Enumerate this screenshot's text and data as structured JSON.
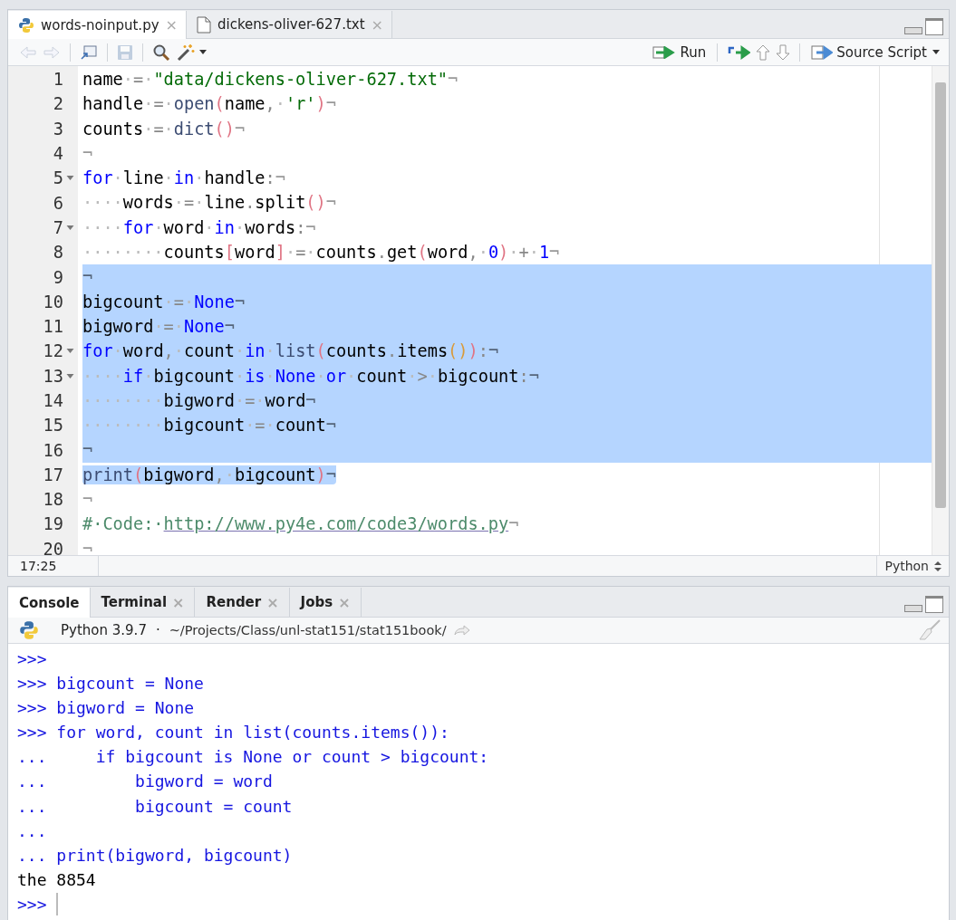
{
  "source_tabs": [
    {
      "label": "words-noinput.py",
      "kind": "python",
      "selected": true,
      "close_icon": "×"
    },
    {
      "label": "dickens-oliver-627.txt",
      "kind": "text",
      "selected": false,
      "close_icon": "×"
    }
  ],
  "toolbar": {
    "run_label": "Run",
    "source_label": "Source Script",
    "back_disabled": true,
    "forward_disabled": true,
    "save_disabled": true
  },
  "editor": {
    "lines": [
      {
        "number": "1",
        "foldable": false,
        "selected": false,
        "tokens": [
          {
            "kind": "id",
            "text": "name"
          },
          {
            "kind": "ws",
            "text": "·"
          },
          {
            "kind": "op",
            "text": "="
          },
          {
            "kind": "ws",
            "text": "·"
          },
          {
            "kind": "str",
            "text": "\"data/dickens-oliver-627.txt\""
          },
          {
            "kind": "eol",
            "text": "¬"
          }
        ]
      },
      {
        "number": "2",
        "foldable": false,
        "selected": false,
        "tokens": [
          {
            "kind": "id",
            "text": "handle"
          },
          {
            "kind": "ws",
            "text": "·"
          },
          {
            "kind": "op",
            "text": "="
          },
          {
            "kind": "ws",
            "text": "·"
          },
          {
            "kind": "builtin",
            "text": "open"
          },
          {
            "kind": "paren",
            "text": "("
          },
          {
            "kind": "id",
            "text": "name"
          },
          {
            "kind": "op",
            "text": ","
          },
          {
            "kind": "ws",
            "text": "·"
          },
          {
            "kind": "str",
            "text": "'r'"
          },
          {
            "kind": "paren",
            "text": ")"
          },
          {
            "kind": "eol",
            "text": "¬"
          }
        ]
      },
      {
        "number": "3",
        "foldable": false,
        "selected": false,
        "tokens": [
          {
            "kind": "id",
            "text": "counts"
          },
          {
            "kind": "ws",
            "text": "·"
          },
          {
            "kind": "op",
            "text": "="
          },
          {
            "kind": "ws",
            "text": "·"
          },
          {
            "kind": "builtin",
            "text": "dict"
          },
          {
            "kind": "paren",
            "text": "()"
          },
          {
            "kind": "eol",
            "text": "¬"
          }
        ]
      },
      {
        "number": "4",
        "foldable": false,
        "selected": false,
        "tokens": [
          {
            "kind": "eol",
            "text": "¬"
          }
        ]
      },
      {
        "number": "5",
        "foldable": true,
        "selected": false,
        "tokens": [
          {
            "kind": "kw",
            "text": "for"
          },
          {
            "kind": "ws",
            "text": "·"
          },
          {
            "kind": "id",
            "text": "line"
          },
          {
            "kind": "ws",
            "text": "·"
          },
          {
            "kind": "kw",
            "text": "in"
          },
          {
            "kind": "ws",
            "text": "·"
          },
          {
            "kind": "id",
            "text": "handle"
          },
          {
            "kind": "op",
            "text": ":"
          },
          {
            "kind": "eol",
            "text": "¬"
          }
        ]
      },
      {
        "number": "6",
        "foldable": false,
        "selected": false,
        "tokens": [
          {
            "kind": "ws",
            "text": "····"
          },
          {
            "kind": "id",
            "text": "words"
          },
          {
            "kind": "ws",
            "text": "·"
          },
          {
            "kind": "op",
            "text": "="
          },
          {
            "kind": "ws",
            "text": "·"
          },
          {
            "kind": "id",
            "text": "line"
          },
          {
            "kind": "op",
            "text": "."
          },
          {
            "kind": "id",
            "text": "split"
          },
          {
            "kind": "paren",
            "text": "()"
          },
          {
            "kind": "eol",
            "text": "¬"
          }
        ]
      },
      {
        "number": "7",
        "foldable": true,
        "selected": false,
        "tokens": [
          {
            "kind": "ws",
            "text": "····"
          },
          {
            "kind": "kw",
            "text": "for"
          },
          {
            "kind": "ws",
            "text": "·"
          },
          {
            "kind": "id",
            "text": "word"
          },
          {
            "kind": "ws",
            "text": "·"
          },
          {
            "kind": "kw",
            "text": "in"
          },
          {
            "kind": "ws",
            "text": "·"
          },
          {
            "kind": "id",
            "text": "words"
          },
          {
            "kind": "op",
            "text": ":"
          },
          {
            "kind": "eol",
            "text": "¬"
          }
        ]
      },
      {
        "number": "8",
        "foldable": false,
        "selected": false,
        "tokens": [
          {
            "kind": "ws",
            "text": "········"
          },
          {
            "kind": "id",
            "text": "counts"
          },
          {
            "kind": "paren",
            "text": "["
          },
          {
            "kind": "id",
            "text": "word"
          },
          {
            "kind": "paren",
            "text": "]"
          },
          {
            "kind": "ws",
            "text": "·"
          },
          {
            "kind": "op",
            "text": "="
          },
          {
            "kind": "ws",
            "text": "·"
          },
          {
            "kind": "id",
            "text": "counts"
          },
          {
            "kind": "op",
            "text": "."
          },
          {
            "kind": "id",
            "text": "get"
          },
          {
            "kind": "paren",
            "text": "("
          },
          {
            "kind": "id",
            "text": "word"
          },
          {
            "kind": "op",
            "text": ","
          },
          {
            "kind": "ws",
            "text": "·"
          },
          {
            "kind": "num",
            "text": "0"
          },
          {
            "kind": "paren",
            "text": ")"
          },
          {
            "kind": "ws",
            "text": "·"
          },
          {
            "kind": "op",
            "text": "+"
          },
          {
            "kind": "ws",
            "text": "·"
          },
          {
            "kind": "num",
            "text": "1"
          },
          {
            "kind": "eol",
            "text": "¬"
          }
        ]
      },
      {
        "number": "9",
        "foldable": false,
        "selected": true,
        "whole_line": true,
        "tokens": [
          {
            "kind": "eol",
            "text": "¬"
          }
        ]
      },
      {
        "number": "10",
        "foldable": false,
        "selected": true,
        "whole_line": true,
        "tokens": [
          {
            "kind": "id",
            "text": "bigcount"
          },
          {
            "kind": "ws",
            "text": "·"
          },
          {
            "kind": "op",
            "text": "="
          },
          {
            "kind": "ws",
            "text": "·"
          },
          {
            "kind": "kw",
            "text": "None"
          },
          {
            "kind": "eol",
            "text": "¬"
          }
        ]
      },
      {
        "number": "11",
        "foldable": false,
        "selected": true,
        "whole_line": true,
        "tokens": [
          {
            "kind": "id",
            "text": "bigword"
          },
          {
            "kind": "ws",
            "text": "·"
          },
          {
            "kind": "op",
            "text": "="
          },
          {
            "kind": "ws",
            "text": "·"
          },
          {
            "kind": "kw",
            "text": "None"
          },
          {
            "kind": "eol",
            "text": "¬"
          }
        ]
      },
      {
        "number": "12",
        "foldable": true,
        "selected": true,
        "whole_line": true,
        "tokens": [
          {
            "kind": "kw",
            "text": "for"
          },
          {
            "kind": "ws",
            "text": "·"
          },
          {
            "kind": "id",
            "text": "word"
          },
          {
            "kind": "op",
            "text": ","
          },
          {
            "kind": "ws",
            "text": "·"
          },
          {
            "kind": "id",
            "text": "count"
          },
          {
            "kind": "ws",
            "text": "·"
          },
          {
            "kind": "kw",
            "text": "in"
          },
          {
            "kind": "ws",
            "text": "·"
          },
          {
            "kind": "builtin",
            "text": "list"
          },
          {
            "kind": "paren",
            "text": "("
          },
          {
            "kind": "id",
            "text": "counts"
          },
          {
            "kind": "op",
            "text": "."
          },
          {
            "kind": "id",
            "text": "items"
          },
          {
            "kind": "paren2",
            "text": "()"
          },
          {
            "kind": "paren",
            "text": ")"
          },
          {
            "kind": "op",
            "text": ":"
          },
          {
            "kind": "eol",
            "text": "¬"
          }
        ]
      },
      {
        "number": "13",
        "foldable": true,
        "selected": true,
        "whole_line": true,
        "tokens": [
          {
            "kind": "ws",
            "text": "····"
          },
          {
            "kind": "kw",
            "text": "if"
          },
          {
            "kind": "ws",
            "text": "·"
          },
          {
            "kind": "id",
            "text": "bigcount"
          },
          {
            "kind": "ws",
            "text": "·"
          },
          {
            "kind": "kw",
            "text": "is"
          },
          {
            "kind": "ws",
            "text": "·"
          },
          {
            "kind": "kw",
            "text": "None"
          },
          {
            "kind": "ws",
            "text": "·"
          },
          {
            "kind": "kw",
            "text": "or"
          },
          {
            "kind": "ws",
            "text": "·"
          },
          {
            "kind": "id",
            "text": "count"
          },
          {
            "kind": "ws",
            "text": "·"
          },
          {
            "kind": "op",
            "text": ">"
          },
          {
            "kind": "ws",
            "text": "·"
          },
          {
            "kind": "id",
            "text": "bigcount"
          },
          {
            "kind": "op",
            "text": ":"
          },
          {
            "kind": "eol",
            "text": "¬"
          }
        ]
      },
      {
        "number": "14",
        "foldable": false,
        "selected": true,
        "whole_line": true,
        "tokens": [
          {
            "kind": "ws",
            "text": "········"
          },
          {
            "kind": "id",
            "text": "bigword"
          },
          {
            "kind": "ws",
            "text": "·"
          },
          {
            "kind": "op",
            "text": "="
          },
          {
            "kind": "ws",
            "text": "·"
          },
          {
            "kind": "id",
            "text": "word"
          },
          {
            "kind": "eol",
            "text": "¬"
          }
        ]
      },
      {
        "number": "15",
        "foldable": false,
        "selected": true,
        "whole_line": true,
        "tokens": [
          {
            "kind": "ws",
            "text": "········"
          },
          {
            "kind": "id",
            "text": "bigcount"
          },
          {
            "kind": "ws",
            "text": "·"
          },
          {
            "kind": "op",
            "text": "="
          },
          {
            "kind": "ws",
            "text": "·"
          },
          {
            "kind": "id",
            "text": "count"
          },
          {
            "kind": "eol",
            "text": "¬"
          }
        ]
      },
      {
        "number": "16",
        "foldable": false,
        "selected": true,
        "whole_line": true,
        "tokens": [
          {
            "kind": "eol",
            "text": "¬"
          }
        ]
      },
      {
        "number": "17",
        "foldable": false,
        "selected": true,
        "whole_line": false,
        "tokens": [
          {
            "kind": "builtin",
            "text": "print"
          },
          {
            "kind": "paren",
            "text": "("
          },
          {
            "kind": "id",
            "text": "bigword"
          },
          {
            "kind": "op",
            "text": ","
          },
          {
            "kind": "ws",
            "text": "·"
          },
          {
            "kind": "id",
            "text": "bigcount"
          },
          {
            "kind": "paren",
            "text": ")"
          },
          {
            "kind": "eol",
            "text": "¬"
          }
        ]
      },
      {
        "number": "18",
        "foldable": false,
        "selected": false,
        "tokens": [
          {
            "kind": "eol",
            "text": "¬"
          }
        ]
      },
      {
        "number": "19",
        "foldable": false,
        "selected": false,
        "tokens": [
          {
            "kind": "comment",
            "text": "#·Code:·"
          },
          {
            "kind": "link",
            "text": "http://www.py4e.com/code3/words.py"
          },
          {
            "kind": "eol",
            "text": "¬"
          }
        ]
      },
      {
        "number": "20",
        "foldable": false,
        "selected": false,
        "tokens": [
          {
            "kind": "eol",
            "text": "¬"
          }
        ]
      }
    ]
  },
  "status_bar": {
    "position": "17:25",
    "language": "Python"
  },
  "console_tabs": [
    {
      "label": "Console",
      "selected": true,
      "closable": false
    },
    {
      "label": "Terminal",
      "selected": false,
      "closable": true,
      "close_icon": "×"
    },
    {
      "label": "Render",
      "selected": false,
      "closable": true,
      "close_icon": "×"
    },
    {
      "label": "Jobs",
      "selected": false,
      "closable": true,
      "close_icon": "×"
    }
  ],
  "console_header": {
    "interpreter": "Python 3.9.7",
    "separator": "·",
    "path": "~/Projects/Class/unl-stat151/stat151book/"
  },
  "console_lines": [
    {
      "kind": "input",
      "text": ">>>",
      "cursor": false
    },
    {
      "kind": "input",
      "text": ">>> bigcount = None",
      "cursor": false
    },
    {
      "kind": "input",
      "text": ">>> bigword = None",
      "cursor": false
    },
    {
      "kind": "input",
      "text": ">>> for word, count in list(counts.items()):",
      "cursor": false
    },
    {
      "kind": "input",
      "text": "...     if bigcount is None or count > bigcount:",
      "cursor": false
    },
    {
      "kind": "input",
      "text": "...         bigword = word",
      "cursor": false
    },
    {
      "kind": "input",
      "text": "...         bigcount = count",
      "cursor": false
    },
    {
      "kind": "input",
      "text": "...",
      "cursor": false
    },
    {
      "kind": "input",
      "text": "... print(bigword, bigcount)",
      "cursor": false
    },
    {
      "kind": "output",
      "text": "the 8854",
      "cursor": false
    },
    {
      "kind": "input",
      "text": ">>>",
      "cursor": true
    }
  ]
}
